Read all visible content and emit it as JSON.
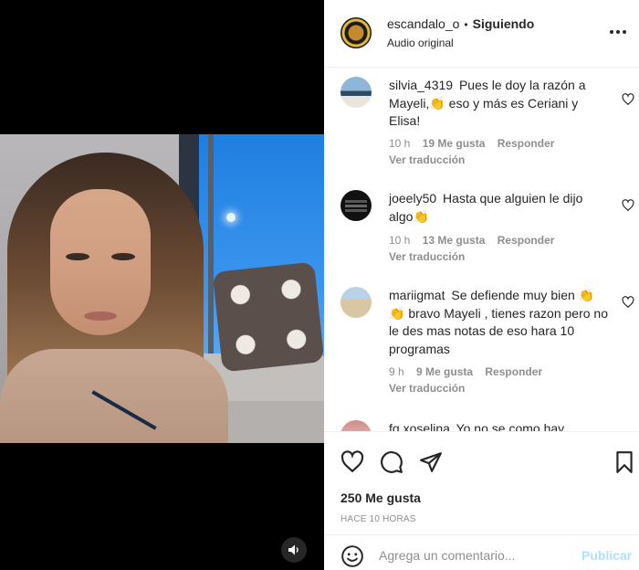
{
  "post": {
    "username": "escandalo_o",
    "separator": "•",
    "follow_status": "Siguiendo",
    "audio": "Audio original",
    "more_icon": "more-horizontal-icon"
  },
  "comments": [
    {
      "username": "silvia_4319",
      "text": "Pues le doy la razón a Mayeli,👏 eso y más es Ceriani y Elisa!",
      "time": "10 h",
      "likes": "19 Me gusta",
      "reply": "Responder",
      "translate": "Ver traducción"
    },
    {
      "username": "joeely50",
      "text": "Hasta que alguien le dijo algo👏",
      "time": "10 h",
      "likes": "13 Me gusta",
      "reply": "Responder",
      "translate": "Ver traducción"
    },
    {
      "username": "mariigmat",
      "text": "Se defiende muy bien 👏👏 bravo Mayeli , tienes razon pero no le des mas notas de eso hara 10 programas",
      "time": "9 h",
      "likes": "9 Me gusta",
      "reply": "Responder",
      "translate": "Ver traducción"
    },
    {
      "username": "fq.xoselina",
      "text": "Yo no se como hay"
    }
  ],
  "actions": {
    "like_icon": "heart-icon",
    "comment_icon": "comment-icon",
    "share_icon": "share-icon",
    "save_icon": "bookmark-icon"
  },
  "likes_count": "250 Me gusta",
  "posted_ago": "HACE 10 HORAS",
  "add_comment": {
    "placeholder": "Agrega un comentario...",
    "publish_label": "Publicar",
    "emoji_icon": "smiley-icon"
  },
  "colors": {
    "text": "#262626",
    "muted": "#8e8e8e",
    "publish_disabled": "#b2dffc",
    "border": "#efefef"
  }
}
